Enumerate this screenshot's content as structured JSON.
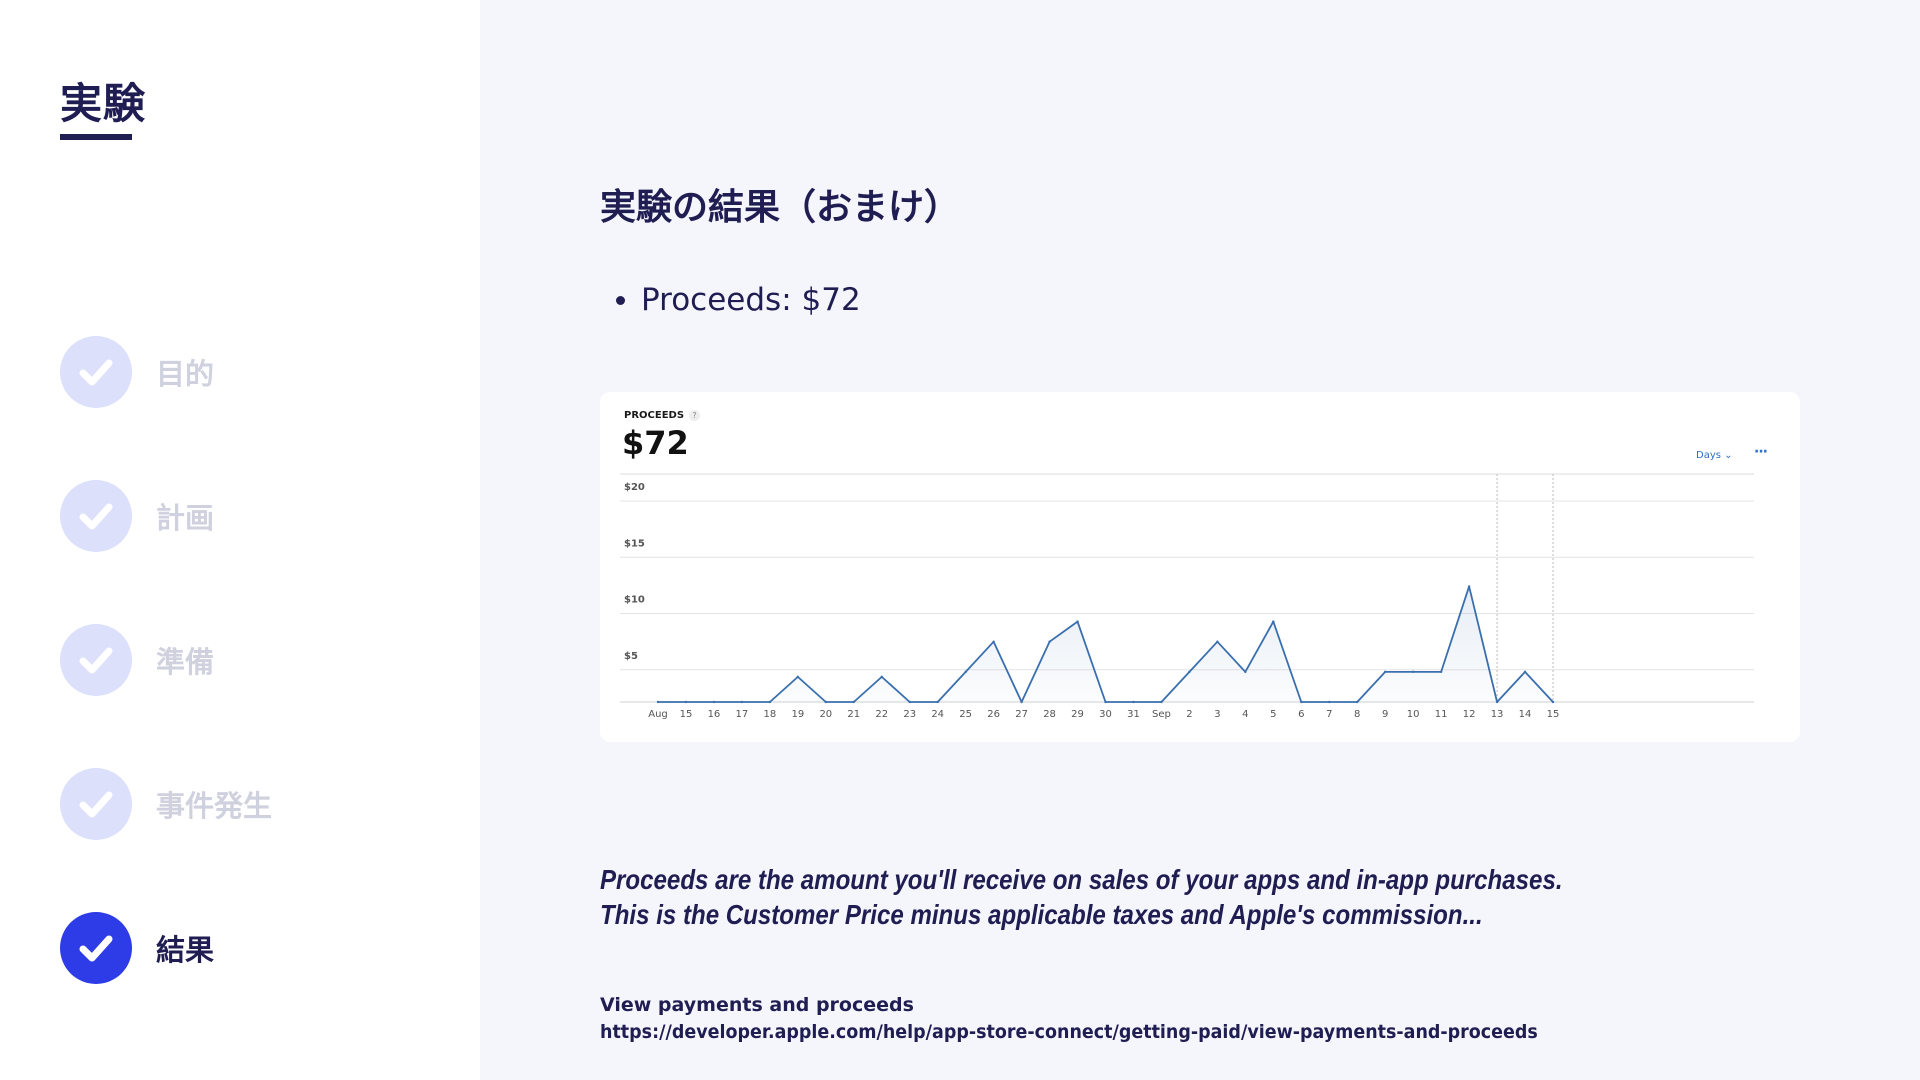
{
  "sidebar": {
    "title": "実験",
    "steps": [
      {
        "label": "目的",
        "active": false
      },
      {
        "label": "計画",
        "active": false
      },
      {
        "label": "準備",
        "active": false
      },
      {
        "label": "事件発生",
        "active": false
      },
      {
        "label": "結果",
        "active": true
      }
    ]
  },
  "main": {
    "title": "実験の結果（おまけ）",
    "bullet": "Proceeds: $72",
    "card": {
      "label": "PROCEEDS",
      "help_icon": "?",
      "value": "$72",
      "period_select": "Days",
      "more_icon": "···"
    },
    "quote_lines": [
      "Proceeds are the amount you'll receive on sales of your apps and in-app purchases.",
      "This is the Customer Price minus applicable taxes and Apple's commission..."
    ],
    "source_title": "View payments and proceeds",
    "source_url": "https://developer.apple.com/help/app-store-connect/getting-paid/view-payments-and-proceeds"
  },
  "colors": {
    "text": "#1f1d52",
    "accent": "#2d3ce6",
    "inactive_circle": "#dde0fb",
    "line": "#3a6fae"
  },
  "chart_data": {
    "type": "area",
    "title": "PROCEEDS",
    "categories": [
      "Aug",
      "15",
      "16",
      "17",
      "18",
      "19",
      "20",
      "21",
      "22",
      "23",
      "24",
      "25",
      "26",
      "27",
      "28",
      "29",
      "30",
      "31",
      "Sep",
      "2",
      "3",
      "4",
      "5",
      "6",
      "7",
      "8",
      "9",
      "10",
      "11",
      "12",
      "13",
      "14",
      "15"
    ],
    "values": [
      0,
      0,
      0,
      0,
      0,
      2.5,
      0,
      0,
      2.5,
      0,
      0,
      3,
      6,
      0,
      6,
      8,
      0,
      0,
      0,
      3,
      6,
      3,
      8,
      0,
      0,
      0,
      3,
      3,
      3,
      11.5,
      0,
      3,
      0
    ],
    "y_ticks": [
      "$20",
      "$15",
      "$10",
      "$5"
    ],
    "ylim": [
      0,
      20
    ],
    "grid": true
  }
}
